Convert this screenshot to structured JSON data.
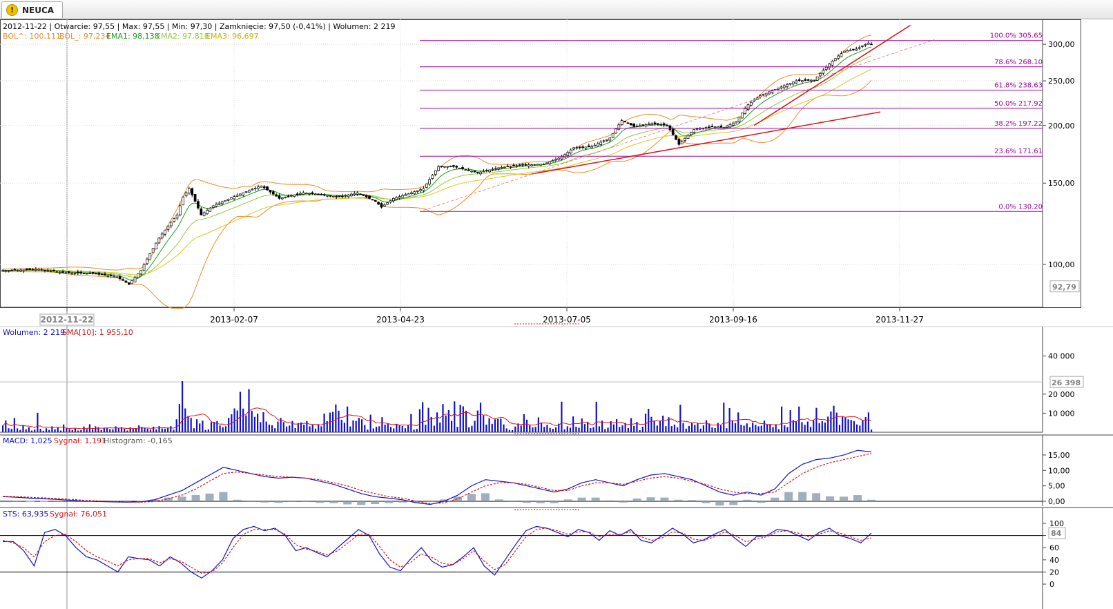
{
  "tab": {
    "label": "NEUCA"
  },
  "price_header": {
    "info": "2012-11-22 | Otwarcie: 97,55 | Max: 97,55 | Min: 97,30 | Zamknięcie: 97,50 (-0,41%) | Wolumen: 2 219",
    "bol_up": "BOL^: 100,111",
    "bol_down": "BOL_: 97,234",
    "ema1": "EMA1: 98,138",
    "ema2": "EMA2: 97,818",
    "ema3": "EMA3: 96,697"
  },
  "volume_header": {
    "vol": "Wolumen: 2 219",
    "sma": "SMA[10]: 1 955,10"
  },
  "macd_header": {
    "macd": "MACD: 1,025",
    "signal": "Sygnał: 1,191",
    "hist": "Histogram: -0,165"
  },
  "sts_header": {
    "sts": "STS: 63,935",
    "signal": "Sygnał: 76,051"
  },
  "colors": {
    "up": "#ffffff",
    "down": "#000000",
    "bol": "#f08a24",
    "ema1": "#1a9a1a",
    "ema2": "#8ccc30",
    "ema3": "#d8c820",
    "fib": "#a000a0",
    "trend": "#e01010",
    "volume": "#1010d0",
    "sma": "#e01010",
    "macd": "#1010d0",
    "macd_signal": "#e01010",
    "hist": "#8a9aaa",
    "sts": "#1010d0",
    "sts_signal": "#e01010"
  },
  "chart_data": [
    {
      "type": "candlestick",
      "title": "NEUCA",
      "x_tick_labels": [
        "2012-11-22",
        "2013-02-07",
        "2013-04-23",
        "2013-07-05",
        "2013-09-16",
        "2013-11-27"
      ],
      "y_tick_labels": [
        "300,00",
        "250,00",
        "200,00",
        "150,00",
        "100,00"
      ],
      "y_ticks": [
        300,
        250,
        200,
        150,
        100
      ],
      "ylim": [
        85,
        315
      ],
      "scale": "log",
      "current_price_label": "92,79",
      "price_anchors": [
        [
          0,
          97
        ],
        [
          12,
          97.5
        ],
        [
          20,
          96
        ],
        [
          30,
          95.5
        ],
        [
          38,
          94
        ],
        [
          42,
          90.5
        ],
        [
          46,
          97
        ],
        [
          52,
          114
        ],
        [
          58,
          128
        ],
        [
          60,
          140
        ],
        [
          62,
          146
        ],
        [
          66,
          128
        ],
        [
          70,
          134
        ],
        [
          80,
          143
        ],
        [
          86,
          148
        ],
        [
          92,
          139
        ],
        [
          100,
          143
        ],
        [
          108,
          141
        ],
        [
          112,
          140
        ],
        [
          118,
          143
        ],
        [
          124,
          137
        ],
        [
          126,
          133
        ],
        [
          130,
          139
        ],
        [
          136,
          143
        ],
        [
          140,
          146
        ],
        [
          145,
          163
        ],
        [
          150,
          163
        ],
        [
          158,
          158
        ],
        [
          165,
          162
        ],
        [
          172,
          164
        ],
        [
          180,
          165
        ],
        [
          186,
          171
        ],
        [
          190,
          179
        ],
        [
          196,
          180
        ],
        [
          202,
          188
        ],
        [
          206,
          205
        ],
        [
          210,
          199
        ],
        [
          216,
          202
        ],
        [
          221,
          200
        ],
        [
          225,
          182
        ],
        [
          230,
          196
        ],
        [
          236,
          199
        ],
        [
          240,
          198
        ],
        [
          244,
          204
        ],
        [
          248,
          222
        ],
        [
          252,
          232
        ],
        [
          258,
          241
        ],
        [
          264,
          250
        ],
        [
          270,
          251
        ],
        [
          276,
          276
        ],
        [
          280,
          290
        ],
        [
          284,
          293
        ],
        [
          288,
          302
        ],
        [
          290,
          298
        ]
      ],
      "fibonacci": [
        {
          "label": "100.0% 305.65",
          "value": 305.65
        },
        {
          "label": "78.6% 268.10",
          "value": 268.1
        },
        {
          "label": "61.8% 238.63",
          "value": 238.63
        },
        {
          "label": "50.0% 217.92",
          "value": 217.92
        },
        {
          "label": "38.2% 197.22",
          "value": 197.22
        },
        {
          "label": "23.6% 171.61",
          "value": 171.61
        },
        {
          "label": "0.0% 130.20",
          "value": 130.2
        }
      ],
      "trendlines": [
        {
          "from": [
            176,
            157
          ],
          "to": [
            292,
            214
          ],
          "style": "solid"
        },
        {
          "from": [
            250,
            200
          ],
          "to": [
            302,
            330
          ],
          "style": "solid"
        },
        {
          "from": [
            140,
            131
          ],
          "to": [
            310,
            307
          ],
          "style": "dashed"
        }
      ]
    },
    {
      "type": "bar",
      "title": "Wolumen",
      "y_tick_labels": [
        "40 000",
        "20 000",
        "10 000"
      ],
      "y_ticks": [
        40000,
        20000,
        10000
      ],
      "ylim": [
        0,
        50000
      ],
      "current_value_label": "26 398",
      "current_value": 26398,
      "values": [
        3500,
        6200,
        2100,
        1800,
        7500,
        2000,
        1200,
        3800,
        1500,
        2600,
        900,
        1400,
        10200,
        1800,
        800,
        2100,
        1200,
        3100,
        1500,
        2600,
        900,
        4100,
        2200,
        1600,
        1200,
        2200,
        900,
        1100,
        3000,
        1600,
        4200,
        1600,
        3100,
        2600,
        1100,
        2400,
        2200,
        1700,
        1500,
        3100,
        2300,
        2700,
        1800,
        900,
        2500,
        1700,
        1800,
        3600,
        2800,
        2400,
        1900,
        1400,
        2900,
        1500,
        3200,
        2000,
        1900,
        2400,
        3200,
        1300,
        6800,
        14800,
        26800,
        12500,
        8500,
        7500,
        2100,
        6800,
        4600,
        6100,
        1200,
        1500,
        5300,
        5400,
        5900,
        3500,
        2600,
        3100,
        7600,
        9400,
        12500,
        11400,
        21200,
        12400,
        8800,
        22600,
        11300,
        8100,
        9800,
        5300,
        10500,
        5600,
        4000,
        3700,
        2100,
        5600,
        7500,
        5300,
        3000,
        3500,
        5900,
        2200,
        4800,
        5100,
        4000,
        5800,
        3100,
        3900,
        1900,
        3900,
        3100,
        9800,
        5800,
        10300,
        10700,
        14600,
        11300,
        6500,
        5000,
        13500,
        3000,
        6200,
        5900,
        7500,
        6800,
        3800,
        1400,
        9200,
        2000,
        2900,
        3100,
        7900,
        4000,
        4500,
        2800,
        2000,
        4200,
        3800,
        3300,
        2100,
        3600,
        9600,
        1300,
        1800,
        12100,
        15800,
        3900,
        12800,
        8000,
        3400,
        10400,
        5100,
        14800,
        8800,
        11600,
        5900,
        16200,
        2800,
        14400,
        13600,
        11300,
        2600,
        3400,
        6000,
        11400,
        15500,
        8800,
        4000,
        7400,
        4400,
        6800,
        6900,
        7100,
        4100,
        2000,
        1200,
        1100,
        3000,
        4600,
        3500,
        9500,
        6600,
        3600,
        2600,
        2800,
        7800,
        4900,
        2800,
        3900,
        2300,
        1800,
        2500,
        4500,
        16000,
        1500,
        3100,
        2400,
        8300,
        2900,
        2400,
        7200,
        4300,
        5100,
        2200,
        2700,
        16000,
        3100,
        6100,
        1600,
        2400,
        5800,
        4100,
        6900,
        2800,
        3600,
        4900,
        2200,
        7400,
        3300,
        5400,
        1100,
        2900,
        9800,
        12300,
        8100,
        6100,
        3500,
        6000,
        8700,
        3200,
        7900,
        3200,
        4000,
        2600,
        14400,
        4800,
        1900,
        3300,
        4800,
        3900,
        4700,
        1900,
        3600,
        6300,
        4600,
        2500,
        2200,
        4900,
        3600,
        15500,
        2100,
        12700,
        6000,
        4800,
        10400,
        3900,
        3500,
        4600,
        2600,
        5000,
        3900,
        3100,
        3400,
        6100,
        4200,
        4200,
        2700,
        4200,
        1600,
        13500,
        3600,
        2700,
        11600,
        6300,
        5800,
        13500,
        5300,
        3900,
        5600,
        2800,
        6200,
        12800,
        4800,
        5800,
        5100,
        8200,
        10900,
        13900,
        10300,
        3900,
        8100,
        7700,
        6800,
        6500,
        5900,
        4100,
        3500,
        6200,
        8000,
        10400,
        1400
      ]
    },
    {
      "type": "line",
      "title": "MACD",
      "y_tick_labels": [
        "15,00",
        "10,00",
        "5,00",
        "0,00"
      ],
      "y_ticks": [
        15,
        10,
        5,
        0
      ],
      "ylim": [
        -2,
        17
      ],
      "series": [
        {
          "name": "MACD",
          "values": [
            1.5,
            1.3,
            1.0,
            0.8,
            0.6,
            0.3,
            0.0,
            -0.1,
            -0.2,
            -0.3,
            -0.2,
            0.5,
            2.0,
            3.5,
            6.0,
            8.5,
            11.0,
            10.0,
            9.0,
            8.0,
            7.5,
            7.8,
            7.5,
            6.5,
            5.5,
            4.0,
            2.5,
            1.5,
            1.0,
            0.5,
            -0.5,
            -1.0,
            0.0,
            2.0,
            5.0,
            7.0,
            6.5,
            6.0,
            5.0,
            4.0,
            3.0,
            4.0,
            6.0,
            7.0,
            6.0,
            5.0,
            7.0,
            8.5,
            9.0,
            8.0,
            7.0,
            5.0,
            3.0,
            2.0,
            3.0,
            2.0,
            4.0,
            9.0,
            12.0,
            13.5,
            14.0,
            15.0,
            16.5,
            16.0
          ]
        },
        {
          "name": "Sygnał",
          "values": [
            1.6,
            1.5,
            1.3,
            1.1,
            0.9,
            0.6,
            0.3,
            0.1,
            0.0,
            -0.2,
            -0.3,
            -0.1,
            0.8,
            2.0,
            4.0,
            6.5,
            9.0,
            9.5,
            9.0,
            8.5,
            8.0,
            7.8,
            7.5,
            7.0,
            6.0,
            5.0,
            3.5,
            2.5,
            1.5,
            1.0,
            0.0,
            -0.8,
            -0.5,
            0.8,
            3.0,
            5.0,
            6.0,
            6.0,
            5.5,
            4.5,
            3.5,
            3.5,
            5.0,
            6.0,
            6.0,
            5.5,
            6.5,
            7.5,
            8.0,
            7.5,
            6.5,
            5.5,
            4.0,
            3.0,
            2.5,
            2.5,
            3.0,
            6.0,
            9.0,
            11.0,
            12.5,
            13.5,
            14.5,
            15.5
          ]
        }
      ],
      "histogram": [
        0.3,
        0.2,
        0.1,
        0.1,
        0.0,
        0.0,
        -0.1,
        0.0,
        0.0,
        0.0,
        0.1,
        0.6,
        1.2,
        1.5,
        2.0,
        2.5,
        3.0,
        0.5,
        0.0,
        -0.4,
        -0.5,
        -0.2,
        0.0,
        -0.5,
        -0.6,
        -1.0,
        -1.2,
        -0.9,
        -0.6,
        -0.4,
        -0.4,
        -0.2,
        0.6,
        1.5,
        2.4,
        2.6,
        0.6,
        0.0,
        -0.5,
        -0.6,
        -0.6,
        0.6,
        1.2,
        1.2,
        0.3,
        -0.4,
        0.9,
        1.3,
        1.2,
        0.5,
        0.4,
        -0.6,
        -1.4,
        -1.2,
        0.5,
        -0.5,
        1.2,
        3.0,
        3.0,
        2.6,
        1.6,
        1.5,
        2.0,
        0.5
      ]
    },
    {
      "type": "line",
      "title": "STS",
      "y_tick_labels": [
        "100",
        "80",
        "60",
        "40",
        "20",
        "0"
      ],
      "y_ticks": [
        100,
        80,
        60,
        40,
        20,
        0
      ],
      "ylim": [
        0,
        105
      ],
      "current_value_label": "84",
      "current_value": 84,
      "series": [
        {
          "name": "STS",
          "values": [
            70,
            70,
            55,
            30,
            85,
            90,
            80,
            60,
            45,
            40,
            30,
            20,
            45,
            42,
            40,
            30,
            45,
            35,
            20,
            10,
            22,
            40,
            75,
            90,
            95,
            88,
            92,
            80,
            55,
            60,
            52,
            45,
            60,
            75,
            90,
            80,
            50,
            28,
            22,
            42,
            60,
            38,
            28,
            32,
            45,
            60,
            30,
            15,
            40,
            65,
            88,
            95,
            92,
            85,
            78,
            90,
            85,
            72,
            88,
            80,
            90,
            72,
            68,
            80,
            92,
            82,
            68,
            73,
            82,
            90,
            75,
            62,
            78,
            80,
            90,
            88,
            80,
            72,
            85,
            92,
            80,
            75,
            68,
            84
          ]
        },
        {
          "name": "Sygnał",
          "values": [
            72,
            68,
            60,
            45,
            70,
            80,
            82,
            70,
            55,
            45,
            38,
            30,
            40,
            42,
            42,
            35,
            42,
            38,
            28,
            18,
            20,
            35,
            60,
            82,
            90,
            90,
            90,
            82,
            65,
            58,
            54,
            48,
            55,
            68,
            82,
            82,
            62,
            40,
            28,
            36,
            50,
            44,
            34,
            32,
            42,
            55,
            38,
            24,
            32,
            55,
            78,
            90,
            92,
            88,
            82,
            86,
            86,
            78,
            82,
            82,
            86,
            78,
            72,
            76,
            86,
            84,
            74,
            72,
            78,
            86,
            80,
            70,
            74,
            78,
            86,
            88,
            84,
            78,
            82,
            88,
            84,
            78,
            72,
            76
          ]
        }
      ]
    }
  ]
}
